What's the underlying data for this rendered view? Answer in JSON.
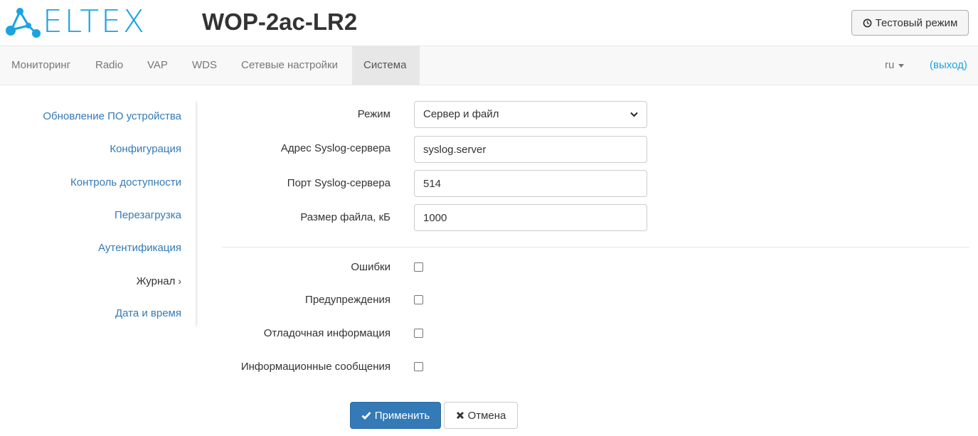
{
  "header": {
    "logo_text": "ELTEX",
    "device_title": "WOP-2ac-LR2",
    "test_mode_label": "Тестовый режим"
  },
  "nav": {
    "items": [
      {
        "label": "Мониторинг"
      },
      {
        "label": "Radio"
      },
      {
        "label": "VAP"
      },
      {
        "label": "WDS"
      },
      {
        "label": "Сетевые настройки"
      },
      {
        "label": "Система",
        "active": true
      }
    ],
    "lang": "ru",
    "logout": "(выход)"
  },
  "sidebar": {
    "items": [
      {
        "label": "Обновление ПО устройства"
      },
      {
        "label": "Конфигурация"
      },
      {
        "label": "Контроль доступности"
      },
      {
        "label": "Перезагрузка"
      },
      {
        "label": "Аутентификация"
      },
      {
        "label": "Журнал",
        "active": true
      },
      {
        "label": "Дата и время"
      }
    ]
  },
  "form": {
    "mode": {
      "label": "Режим",
      "value": "Сервер и файл"
    },
    "server_address": {
      "label": "Адрес Syslog-сервера",
      "value": "syslog.server"
    },
    "server_port": {
      "label": "Порт Syslog-сервера",
      "value": "514"
    },
    "file_size": {
      "label": "Размер файла, кБ",
      "value": "1000"
    },
    "checkboxes": [
      {
        "label": "Ошибки",
        "checked": false
      },
      {
        "label": "Предупреждения",
        "checked": false
      },
      {
        "label": "Отладочная информация",
        "checked": false
      },
      {
        "label": "Информационные сообщения",
        "checked": false
      }
    ]
  },
  "actions": {
    "apply": "Применить",
    "cancel": "Отмена"
  },
  "colors": {
    "brand": "#1aa3e0",
    "primary": "#337ab7",
    "link": "#337ab7"
  }
}
